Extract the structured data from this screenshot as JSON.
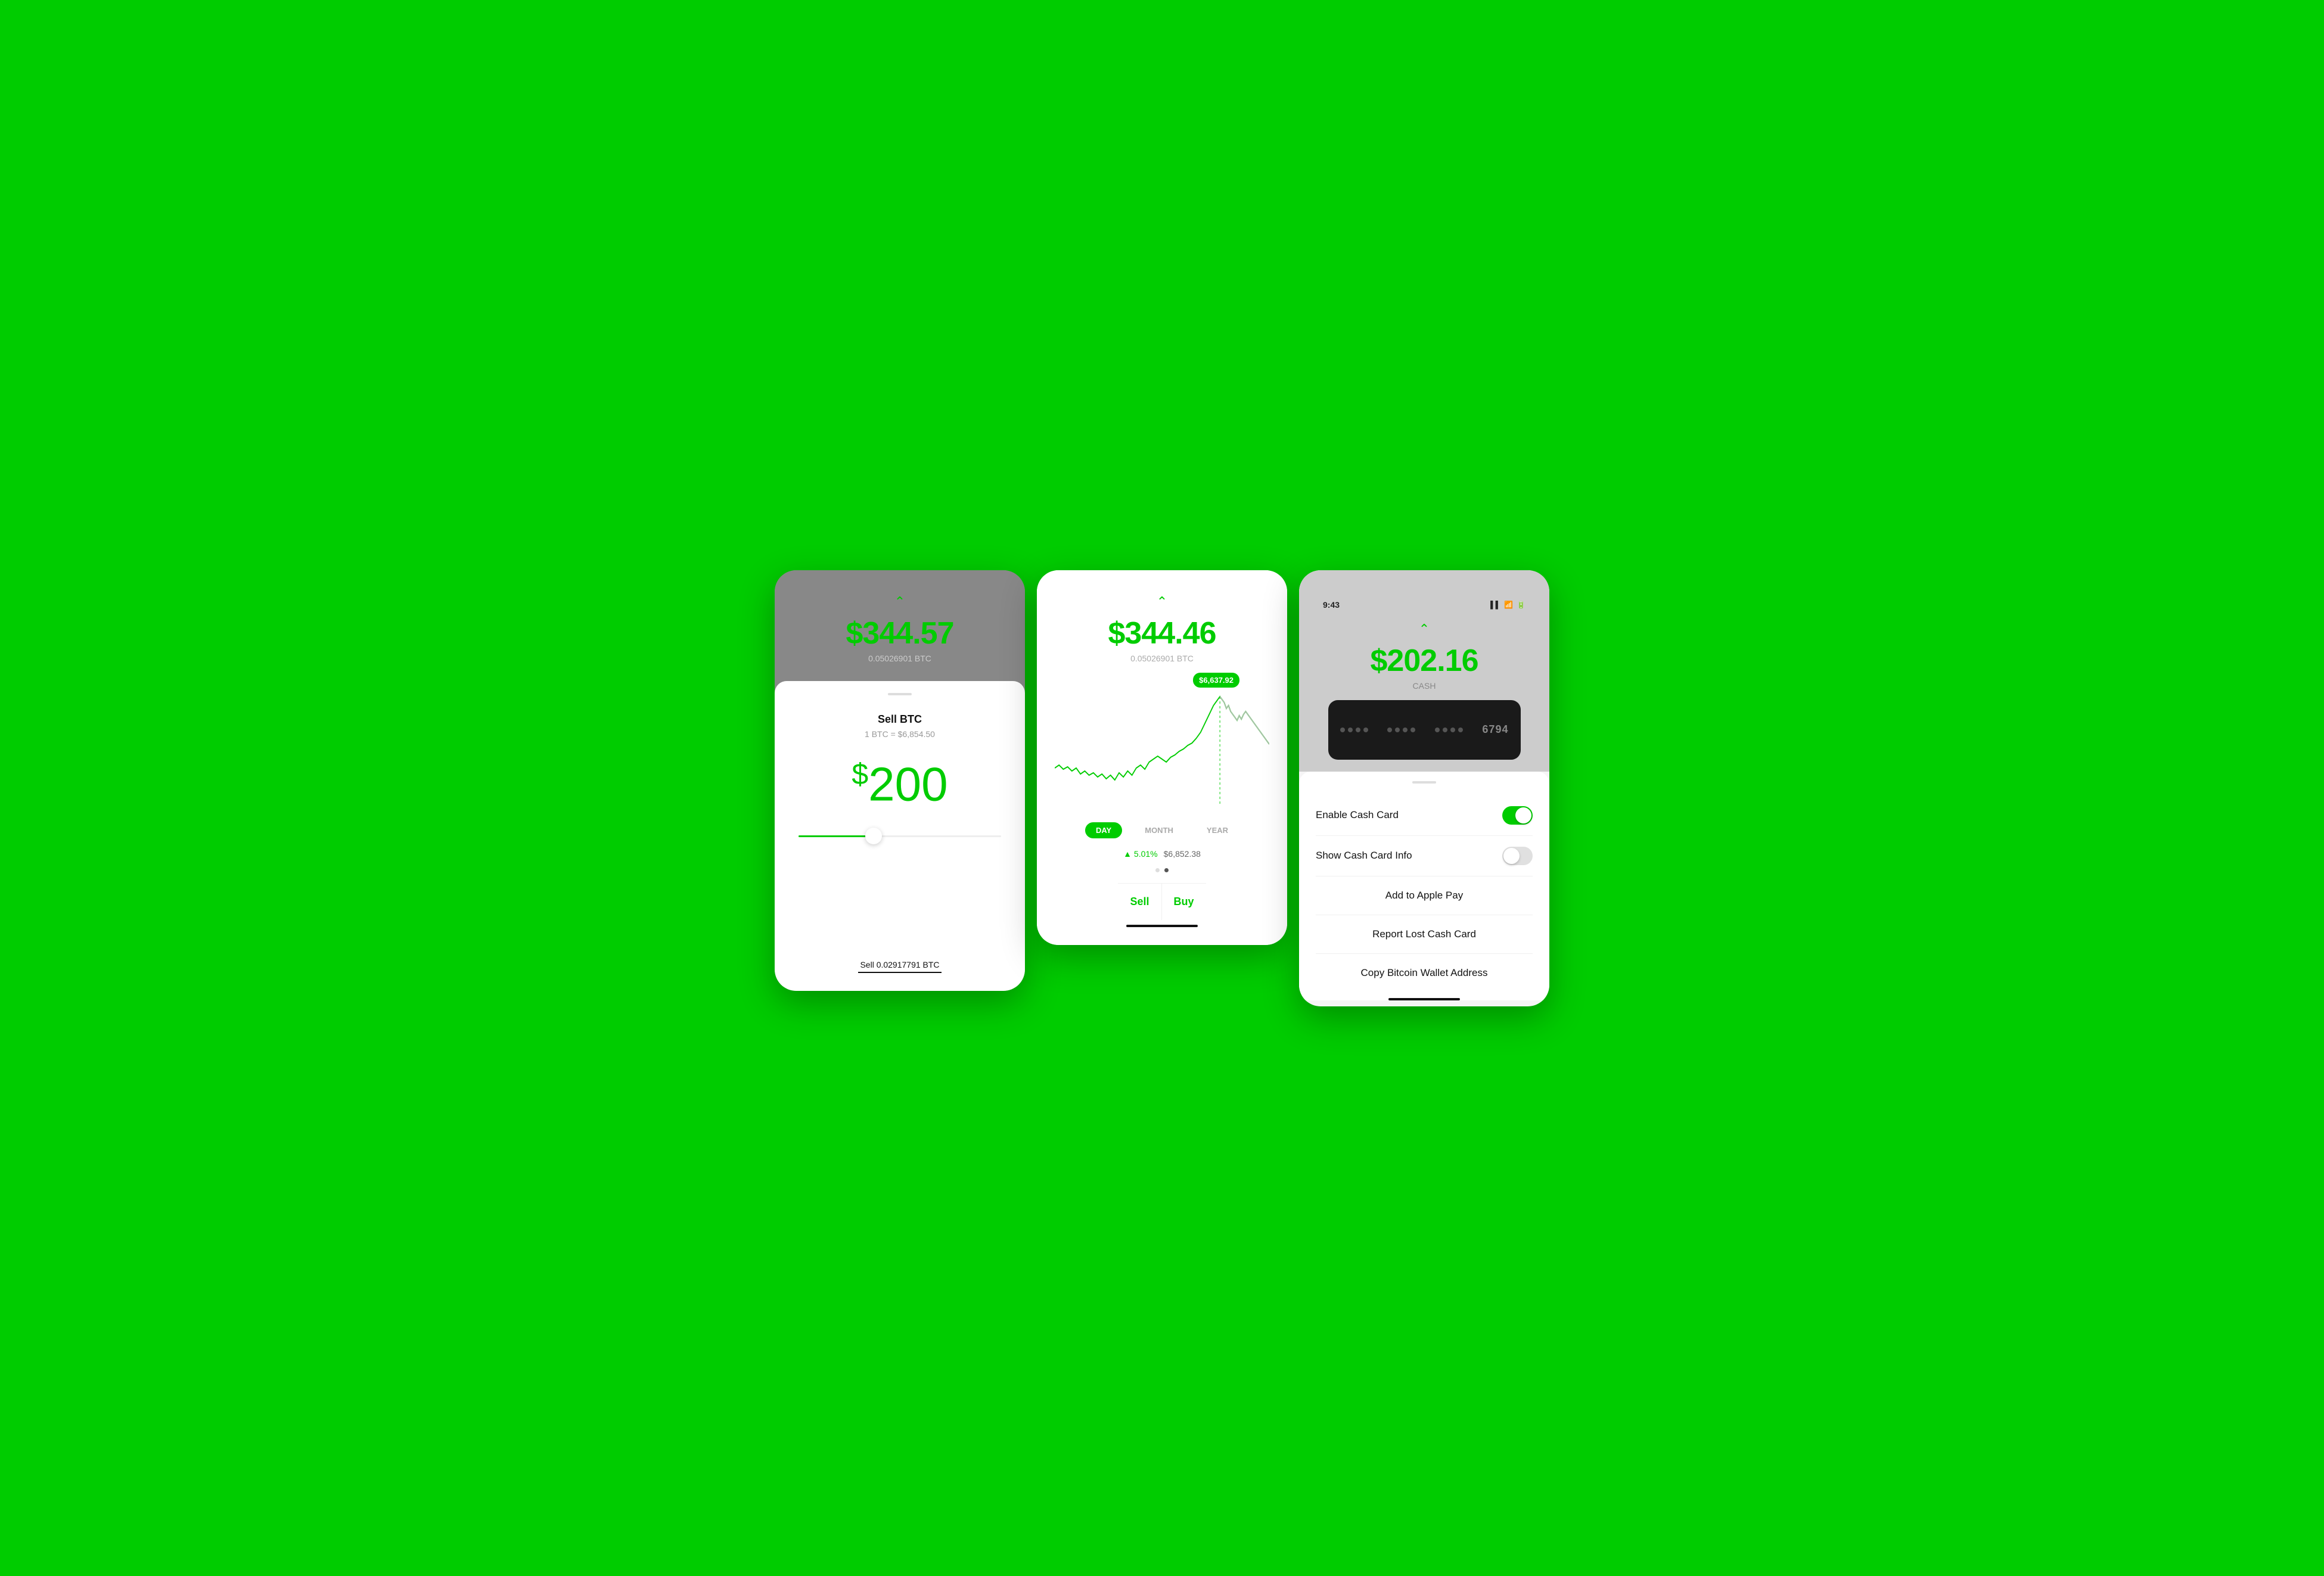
{
  "background_color": "#00CC00",
  "screen1": {
    "top_price": "$344.57",
    "btc_amount": "0.05026901 BTC",
    "chevron": "^",
    "sheet": {
      "title": "Sell BTC",
      "rate": "1 BTC = $6,854.50",
      "amount": "$200",
      "slider_pct": 35,
      "sell_label": "Sell 0.02917791 BTC"
    }
  },
  "screen2": {
    "top_price": "$344.46",
    "btc_amount": "0.05026901 BTC",
    "chevron": "^",
    "tooltip_price": "$6,637.92",
    "period_buttons": [
      "DAY",
      "MONTH",
      "YEAR"
    ],
    "active_period": "DAY",
    "stats_pct": "5.01%",
    "stats_price": "$6,852.38",
    "action_sell": "Sell",
    "action_buy": "Buy"
  },
  "screen3": {
    "status_time": "9:43",
    "top_amount": "$202.16",
    "cash_label": "CASH",
    "card_last4": "6794",
    "sheet": {
      "enable_label": "Enable Cash Card",
      "enable_on": true,
      "show_info_label": "Show Cash Card Info",
      "show_info_on": false,
      "add_apple_pay": "Add to Apple Pay",
      "report_lost": "Report Lost Cash Card",
      "copy_bitcoin": "Copy Bitcoin Wallet Address"
    }
  }
}
